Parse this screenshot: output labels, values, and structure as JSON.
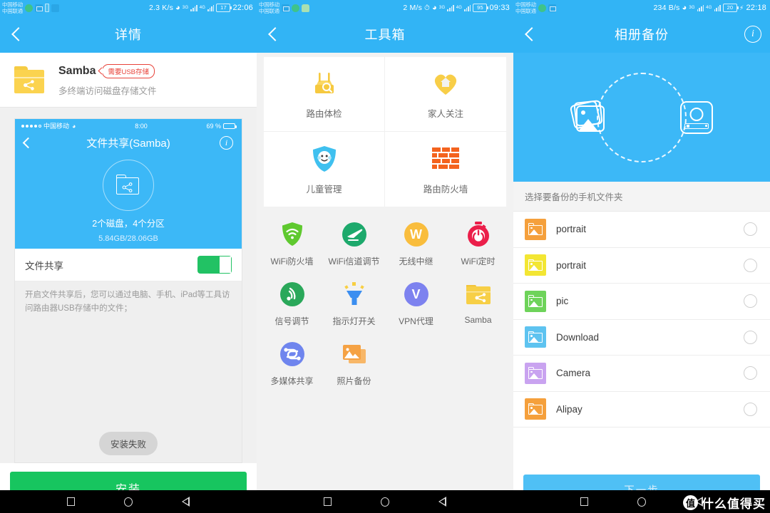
{
  "panels": [
    {
      "status": {
        "carrier1": "中国移动",
        "carrier2": "中国联通",
        "speed": "2.3 K/s",
        "net1": "3G",
        "net2": "4G",
        "battery": "17",
        "clock": "22:06"
      },
      "header": {
        "title": "详情",
        "back_icon": "chevron-left-icon"
      },
      "app": {
        "name": "Samba",
        "badge": "需要USB存储",
        "subtitle": "多终端访问磁盘存储文件"
      },
      "preview": {
        "ios_dots": 5,
        "ios_carrier": "中国移动",
        "ios_time": "8:00",
        "ios_battery": "69 %",
        "ios_title": "文件共享(Samba)",
        "stat_main": "2个磁盘，4个分区",
        "stat_sub": "5.84GB/28.06GB"
      },
      "share_row": {
        "label": "文件共享",
        "toggle_state": "on"
      },
      "description": "开启文件共享后，您可以通过电脑、手机、iPad等工具访问路由器USB存储中的文件；",
      "toast": "安装失败",
      "install_button": "安装"
    },
    {
      "status": {
        "carrier1": "中国移动",
        "carrier2": "中国联通",
        "speed": "2 M/s",
        "net1": "3G",
        "net2": "4G",
        "battery": "95",
        "clock": "09:33"
      },
      "header": {
        "title": "工具箱",
        "back_icon": "chevron-left-icon"
      },
      "grid": [
        {
          "label": "路由体检",
          "icon": "router-checkup-icon",
          "color": "#fbd14f"
        },
        {
          "label": "家人关注",
          "icon": "family-heart-icon",
          "color": "#fbd14f"
        },
        {
          "label": "儿童管理",
          "icon": "child-shield-icon",
          "color": "#41c3f0"
        },
        {
          "label": "路由防火墙",
          "icon": "brick-firewall-icon",
          "color": "#f4631e"
        }
      ],
      "tiles": [
        {
          "label": "WiFi防火墙",
          "icon": "wifi-shield-icon",
          "color": "#5fc92f"
        },
        {
          "label": "WiFi信道调节",
          "icon": "plane-circle-icon",
          "color": "#1da96c"
        },
        {
          "label": "无线中继",
          "icon": "w-circle-icon",
          "color": "#f9bd3d"
        },
        {
          "label": "WiFi定时",
          "icon": "timer-power-icon",
          "color": "#eb1f4a"
        },
        {
          "label": "信号调节",
          "icon": "signal-circle-icon",
          "color": "#2aa85a"
        },
        {
          "label": "指示灯开关",
          "icon": "indicator-lamp-icon",
          "color": "#3b8ef0"
        },
        {
          "label": "VPN代理",
          "icon": "vpn-circle-icon",
          "color": "#7d82ef"
        },
        {
          "label": "Samba",
          "icon": "folder-share-icon",
          "color": "#f7cf46"
        },
        {
          "label": "多媒体共享",
          "icon": "media-share-icon",
          "color": "#6f85ee"
        },
        {
          "label": "照片备份",
          "icon": "photo-backup-icon",
          "color": "#f5a244"
        }
      ]
    },
    {
      "status": {
        "carrier1": "中国移动",
        "carrier2": "中国联通",
        "speed": "234 B/s",
        "net1": "3G",
        "net2": "4G",
        "battery": "20",
        "clock": "22:18"
      },
      "header": {
        "title": "相册备份",
        "back_icon": "chevron-left-icon",
        "info_icon": "info-circle-icon"
      },
      "hero": {
        "left_icon": "photo-stack-icon",
        "right_icon": "hard-drive-icon",
        "ring": "dashed-sync-circle"
      },
      "list_header": "选择要备份的手机文件夹",
      "folders": [
        {
          "name": "portrait",
          "color": "#f5a03c",
          "selected": false
        },
        {
          "name": "portrait",
          "color": "#f3e633",
          "selected": false
        },
        {
          "name": "pic",
          "color": "#6ed35a",
          "selected": false
        },
        {
          "name": "Download",
          "color": "#5ec3f0",
          "selected": false
        },
        {
          "name": "Camera",
          "color": "#c9a3f0",
          "selected": false
        },
        {
          "name": "Alipay",
          "color": "#f5a03c",
          "selected": false
        }
      ],
      "next_button": "下一步"
    }
  ],
  "navbar": {
    "recents_icon": "square-recents-icon",
    "home_icon": "circle-home-icon",
    "back_icon": "triangle-back-icon"
  },
  "watermark": {
    "logo": "值",
    "text": "什么值得买"
  },
  "colors": {
    "brand_blue": "#32b4f5",
    "install_green": "#17c55f",
    "badge_red": "#e8433a",
    "next_blue": "#4fc0f5"
  }
}
